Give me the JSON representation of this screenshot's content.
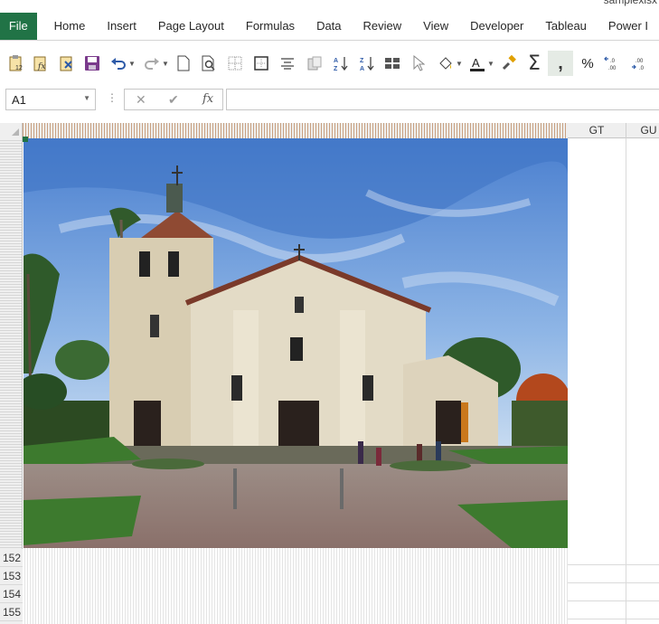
{
  "window": {
    "title_fragment": "samplexlsx"
  },
  "ribbon": {
    "tabs": [
      "File",
      "Home",
      "Insert",
      "Page Layout",
      "Formulas",
      "Data",
      "Review",
      "View",
      "Developer",
      "Tableau",
      "Power I"
    ]
  },
  "toolbar": {
    "icons": [
      "clipboard-number-icon",
      "function-icon",
      "copy-format-icon",
      "save-icon",
      "undo-icon",
      "redo-icon",
      "new-page-icon",
      "print-preview-icon",
      "borders-icon",
      "outside-border-icon",
      "align-center-icon",
      "paste-special-icon",
      "sort-ascending-icon",
      "sort-descending-icon",
      "merge-cells-icon",
      "select-pointer-icon",
      "fill-color-icon",
      "font-color-icon",
      "format-painter-icon",
      "autosum-icon",
      "comma-style-icon",
      "percent-icon",
      "increase-decimal-icon",
      "decrease-decimal-icon"
    ],
    "percent_label": "%",
    "comma_label": ",",
    "sigma_label": "Σ"
  },
  "formula_bar": {
    "name_box_value": "A1",
    "cancel_label": "✕",
    "enter_label": "✔",
    "fx_label": "fx",
    "formula_value": ""
  },
  "grid": {
    "columns": [
      "GT",
      "GU"
    ],
    "rows": [
      "152",
      "153",
      "154",
      "155"
    ]
  },
  "picture": {
    "subject": "mission-church-photo"
  },
  "colors": {
    "accent": "#217346",
    "header_bg": "#efefef",
    "grid_line": "#dadada"
  }
}
